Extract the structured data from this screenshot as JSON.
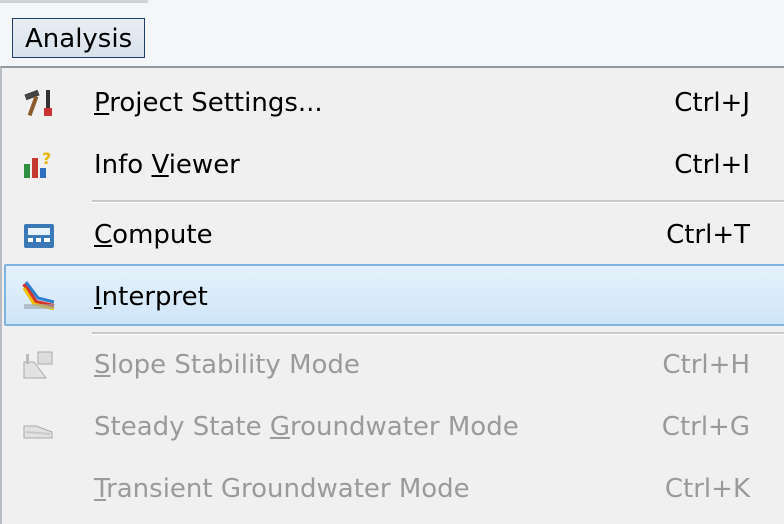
{
  "menubar": {
    "title": "Analysis"
  },
  "items": [
    {
      "label": "Project Settings...",
      "shortcut": "Ctrl+J",
      "icon": "hammer-settings-icon",
      "enabled": true
    },
    {
      "label": "Info Viewer",
      "shortcut": "Ctrl+I",
      "icon": "info-viewer-icon",
      "enabled": true
    },
    {
      "label": "Compute",
      "shortcut": "Ctrl+T",
      "icon": "compute-icon",
      "enabled": true
    },
    {
      "label": "Interpret",
      "shortcut": "",
      "icon": "interpret-icon",
      "enabled": true,
      "highlighted": true
    },
    {
      "label": "Slope Stability Mode",
      "shortcut": "Ctrl+H",
      "icon": "slope-stability-icon",
      "enabled": false
    },
    {
      "label": "Steady State Groundwater Mode",
      "shortcut": "Ctrl+G",
      "icon": "steady-groundwater-icon",
      "enabled": false
    },
    {
      "label": "Transient Groundwater Mode",
      "shortcut": "Ctrl+K",
      "icon": "",
      "enabled": false
    }
  ],
  "colors": {
    "highlight_bg": "#cfe6f8",
    "highlight_border": "#7fb4de",
    "disabled_text": "#9a9a9a"
  }
}
